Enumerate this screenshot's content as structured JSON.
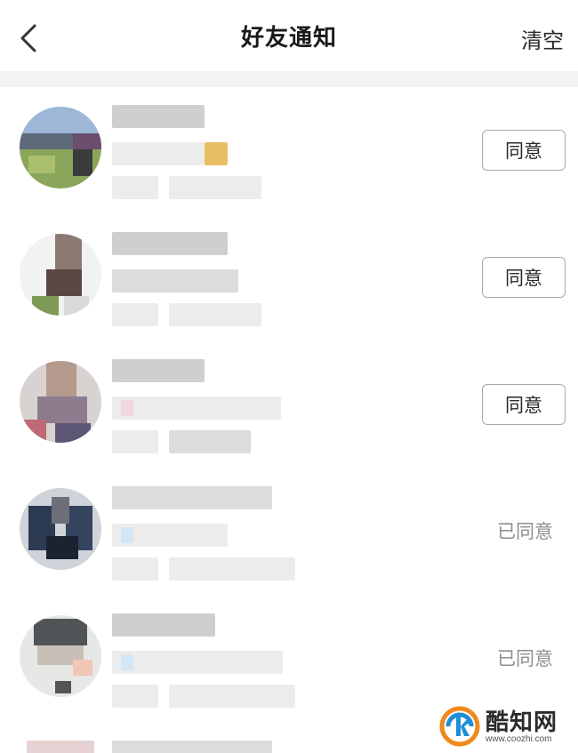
{
  "header": {
    "title": "好友通知",
    "clear_label": "清空",
    "back_icon": "chevron-left-icon"
  },
  "requests": [
    {
      "action": "agree",
      "action_label": "同意"
    },
    {
      "action": "agree",
      "action_label": "同意"
    },
    {
      "action": "agree",
      "action_label": "同意"
    },
    {
      "action": "agreed",
      "action_label": "已同意"
    },
    {
      "action": "agreed",
      "action_label": "已同意"
    }
  ],
  "watermark": {
    "name": "酷知网",
    "url": "www.coozhi.com"
  },
  "colors": {
    "text_primary": "#1a1a1a",
    "text_muted": "#8f8f8f",
    "button_border": "#a9a9a9",
    "divider": "#f4f4f4",
    "watermark_orange": "#f08a1c",
    "watermark_blue": "#1e8fd6"
  }
}
